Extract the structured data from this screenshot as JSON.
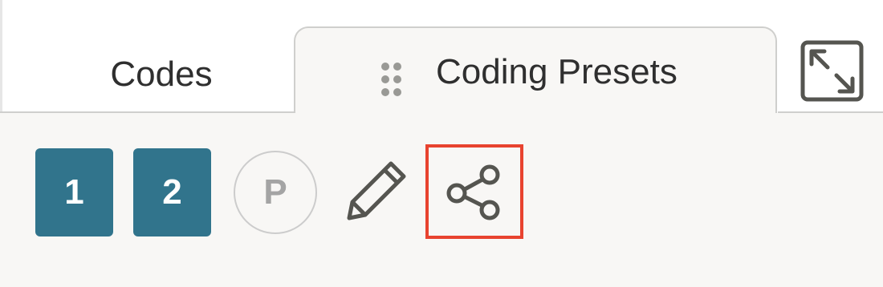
{
  "tabs": {
    "codes_label": "Codes",
    "presets_label": "Coding Presets"
  },
  "presets": {
    "badge_1": "1",
    "badge_2": "2",
    "badge_p": "P"
  },
  "icons": {
    "drag": "drag-handle-icon",
    "expand": "expand-icon",
    "edit": "pencil-icon",
    "share": "share-icon"
  },
  "colors": {
    "badge_bg": "#31748c",
    "highlight": "#e8432f",
    "icon": "#555550",
    "panel_bg": "#f8f7f5"
  }
}
